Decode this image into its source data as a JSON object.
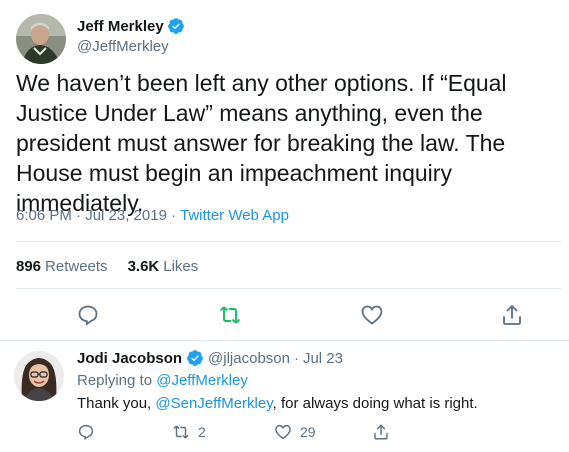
{
  "tweet": {
    "author_name": "Jeff Merkley",
    "handle": "@JeffMerkley",
    "text": "We haven’t been left any other options. If “Equal Justice Under Law” means anything, even the president must answer for breaking the law. The House must begin an impeachment inquiry immediately.",
    "time": "6:06 PM · Jul 23, 2019 · ",
    "source": "Twitter Web App",
    "retweets_count": "896",
    "retweets_label": "Retweets",
    "likes_count": "3.6K",
    "likes_label": "Likes"
  },
  "reply": {
    "author_name": "Jodi Jacobson",
    "handle": "@jljacobson",
    "dot": "·",
    "date": "Jul 23",
    "replying_prefix": "Replying to ",
    "replying_to": "@JeffMerkley",
    "text_before": "Thank you, ",
    "mention": "@SenJeffMerkley",
    "text_after": ", for always doing what is right.",
    "retweet_count": "2",
    "like_count": "29"
  },
  "colors": {
    "accent": "#1b95e0",
    "retweet_green": "#17bf63",
    "text": "#14171a",
    "secondary": "#5b7083"
  }
}
